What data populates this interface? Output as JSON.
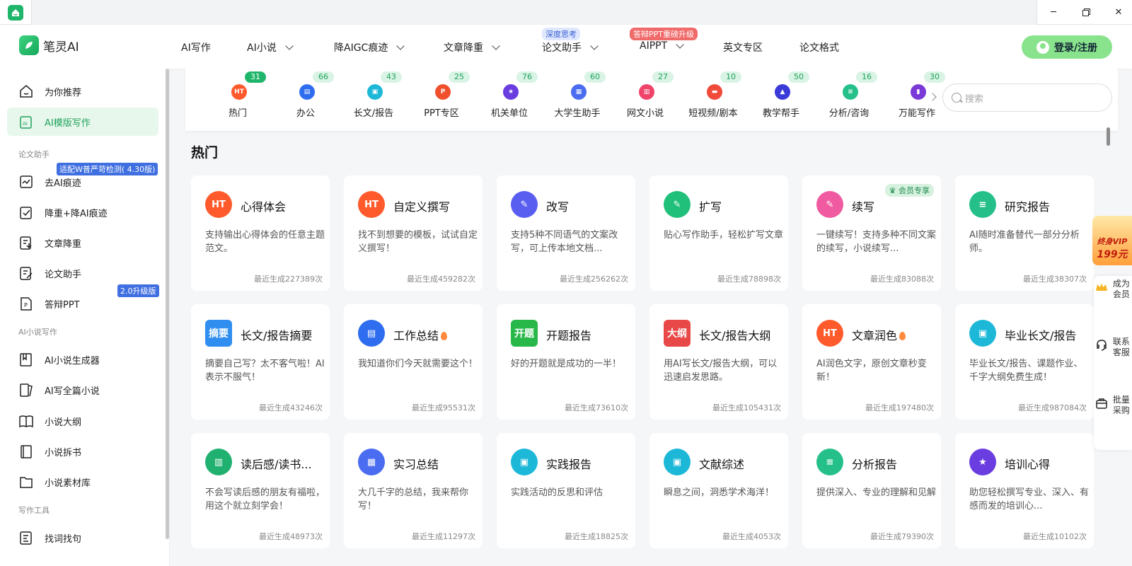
{
  "window": {
    "title": ""
  },
  "header": {
    "logo_text": "笔灵AI",
    "nav": [
      {
        "label": "AI写作",
        "dropdown": false
      },
      {
        "label": "AI小说",
        "dropdown": true
      },
      {
        "label": "降AIGC痕迹",
        "dropdown": true
      },
      {
        "label": "文章降重",
        "dropdown": true
      },
      {
        "label": "论文助手",
        "dropdown": true,
        "badge": "深度思考"
      },
      {
        "label": "AIPPT",
        "dropdown": true,
        "badge": "答辩PPT重磅升级"
      },
      {
        "label": "英文专区",
        "dropdown": false
      },
      {
        "label": "论文格式",
        "dropdown": false
      }
    ],
    "login_label": "登录/注册"
  },
  "sidebar": {
    "items": [
      {
        "label": "为你推荐",
        "icon": "home-icon",
        "active": false
      },
      {
        "label": "AI模版写作",
        "icon": "ai-template-icon",
        "active": true
      }
    ],
    "sections": [
      {
        "title": "论文助手",
        "items": [
          {
            "label": "去AI痕迹",
            "icon": "remove-ai-icon",
            "badge": "适配W普严苛检测( 4.30版)"
          },
          {
            "label": "降重+降AI痕迹",
            "icon": "check-doc-icon"
          },
          {
            "label": "文章降重",
            "icon": "reduce-icon"
          },
          {
            "label": "论文助手",
            "icon": "pen-doc-icon"
          },
          {
            "label": "答辩PPT",
            "icon": "ppt-icon",
            "badge": "2.0升级版"
          }
        ]
      },
      {
        "title": "AI小说写作",
        "items": [
          {
            "label": "AI小说生成器",
            "icon": "book-icon"
          },
          {
            "label": "AI写全篇小说",
            "icon": "books-icon"
          },
          {
            "label": "小说大纲",
            "icon": "open-book-icon"
          },
          {
            "label": "小说拆书",
            "icon": "notebook-icon"
          },
          {
            "label": "小说素材库",
            "icon": "folder-icon"
          }
        ]
      },
      {
        "title": "写作工具",
        "items": [
          {
            "label": "找词找句",
            "icon": "search-doc-icon"
          }
        ]
      }
    ]
  },
  "categories": [
    {
      "label": "热门",
      "count": "31",
      "color": "#ff5a2c",
      "icon": "fire-icon",
      "glyph": "HT"
    },
    {
      "label": "办公",
      "count": "66",
      "color": "#2f6df0",
      "icon": "briefcase-icon",
      "glyph": "▤"
    },
    {
      "label": "长文/报告",
      "count": "43",
      "color": "#1db8d8",
      "icon": "report-icon",
      "glyph": "▣"
    },
    {
      "label": "PPT专区",
      "count": "25",
      "color": "#f0502c",
      "icon": "ppt-icon",
      "glyph": "P"
    },
    {
      "label": "机关单位",
      "count": "76",
      "color": "#6a3de0",
      "icon": "badge-icon",
      "glyph": "★"
    },
    {
      "label": "大学生助手",
      "count": "60",
      "color": "#4a6cf0",
      "icon": "student-icon",
      "glyph": "▦"
    },
    {
      "label": "网文小说",
      "count": "27",
      "color": "#f0436a",
      "icon": "novel-icon",
      "glyph": "▥"
    },
    {
      "label": "短视频/剧本",
      "count": "10",
      "color": "#f04a3a",
      "icon": "clapper-icon",
      "glyph": "▬"
    },
    {
      "label": "教学帮手",
      "count": "50",
      "color": "#3a3ad8",
      "icon": "graduation-icon",
      "glyph": "▲"
    },
    {
      "label": "分析/咨询",
      "count": "16",
      "color": "#25c08a",
      "icon": "analysis-icon",
      "glyph": "≡"
    },
    {
      "label": "万能写作",
      "count": "30",
      "color": "#7a3ad8",
      "icon": "universal-icon",
      "glyph": "▮"
    }
  ],
  "search": {
    "placeholder": "搜索"
  },
  "section_title": "热门",
  "cards": [
    {
      "title": "心得体会",
      "desc": "支持输出心得体会的任意主题范文。",
      "meta": "最近生成227389次",
      "icon": "fire-icon",
      "glyph": "HT",
      "color": "#ff5a2c"
    },
    {
      "title": "自定义撰写",
      "desc": "找不到想要的模板，试试自定义撰写！",
      "meta": "最近生成459282次",
      "icon": "fire-icon",
      "glyph": "HT",
      "color": "#ff5a2c"
    },
    {
      "title": "改写",
      "desc": "支持5种不同语气的文案改写，可上传本地文档...",
      "meta": "最近生成256262次",
      "icon": "feather-icon",
      "glyph": "✎",
      "color": "#5a5ef0"
    },
    {
      "title": "扩写",
      "desc": "贴心写作助手，轻松扩写文章",
      "meta": "最近生成78898次",
      "icon": "edit-icon",
      "glyph": "✎",
      "color": "#20c07a"
    },
    {
      "title": "续写",
      "desc": "一键续写！支持多种不同文案的续写，小说续写...",
      "meta": "最近生成83088次",
      "icon": "continue-icon",
      "glyph": "✎",
      "color": "#f05aa0",
      "member": "会员专享"
    },
    {
      "title": "研究报告",
      "desc": "AI随时准备替代一部分分析师。",
      "meta": "最近生成38307次",
      "icon": "doc-icon",
      "glyph": "≡",
      "color": "#25c08a"
    },
    {
      "title": "长文/报告摘要",
      "desc": "摘要自己写？太不客气啦！AI表示不服气！",
      "meta": "最近生成43246次",
      "icon": "summary-icon",
      "glyph": "摘要",
      "color": "#2f8ef0",
      "square": true
    },
    {
      "title": "工作总结",
      "desc": "我知道你们今天就需要这个！",
      "meta": "最近生成95531次",
      "icon": "briefcase-icon",
      "glyph": "▤",
      "color": "#2f6df0",
      "hot": true
    },
    {
      "title": "开题报告",
      "desc": "好的开题就是成功的一半！",
      "meta": "最近生成73610次",
      "icon": "opening-icon",
      "glyph": "开题",
      "color": "#28b84a",
      "square": true
    },
    {
      "title": "长文/报告大纲",
      "desc": "用AI写长文/报告大纲，可以迅速启发思路。",
      "meta": "最近生成105431次",
      "icon": "outline-icon",
      "glyph": "大纲",
      "color": "#e84848",
      "square": true
    },
    {
      "title": "文章润色",
      "desc": "AI润色文字，原创文章秒变新！",
      "meta": "最近生成197480次",
      "icon": "fire-icon",
      "glyph": "HT",
      "color": "#ff5a2c",
      "hot": true
    },
    {
      "title": "毕业长文/报告",
      "desc": "毕业长文/报告、课题作业、千字大纲免费生成！",
      "meta": "最近生成987084次",
      "icon": "book-open-icon",
      "glyph": "▣",
      "color": "#1db8d8"
    },
    {
      "title": "读后感/读书...",
      "desc": "不会写读后感的朋友有福啦，用这个就立刻学会！",
      "meta": "最近生成48973次",
      "icon": "notebook-icon",
      "glyph": "▥",
      "color": "#20b070"
    },
    {
      "title": "实习总结",
      "desc": "大几千字的总结，我来帮你写！",
      "meta": "最近生成11297次",
      "icon": "intern-icon",
      "glyph": "▦",
      "color": "#4a6cf0"
    },
    {
      "title": "实践报告",
      "desc": "实践活动的反思和评估",
      "meta": "最近生成18825次",
      "icon": "book-open-icon",
      "glyph": "▣",
      "color": "#1db8d8"
    },
    {
      "title": "文献综述",
      "desc": "瞬息之间，洞悉学术海洋！",
      "meta": "最近生成4053次",
      "icon": "book-open-icon",
      "glyph": "▣",
      "color": "#1db8d8"
    },
    {
      "title": "分析报告",
      "desc": "提供深入、专业的理解和见解",
      "meta": "最近生成79390次",
      "icon": "doc-icon",
      "glyph": "≡",
      "color": "#25c08a"
    },
    {
      "title": "培训心得",
      "desc": "助您轻松撰写专业、深入、有感而发的培训心...",
      "meta": "最近生成10102次",
      "icon": "badge-icon",
      "glyph": "★",
      "color": "#6a3de0"
    }
  ],
  "floating": {
    "vip_line1": "终身VIP",
    "vip_line2": "199元",
    "items": [
      {
        "label": "成为会员",
        "icon": "crown-icon"
      },
      {
        "label": "联系客服",
        "icon": "headset-icon"
      },
      {
        "label": "批量采购",
        "icon": "bag-icon"
      }
    ]
  }
}
